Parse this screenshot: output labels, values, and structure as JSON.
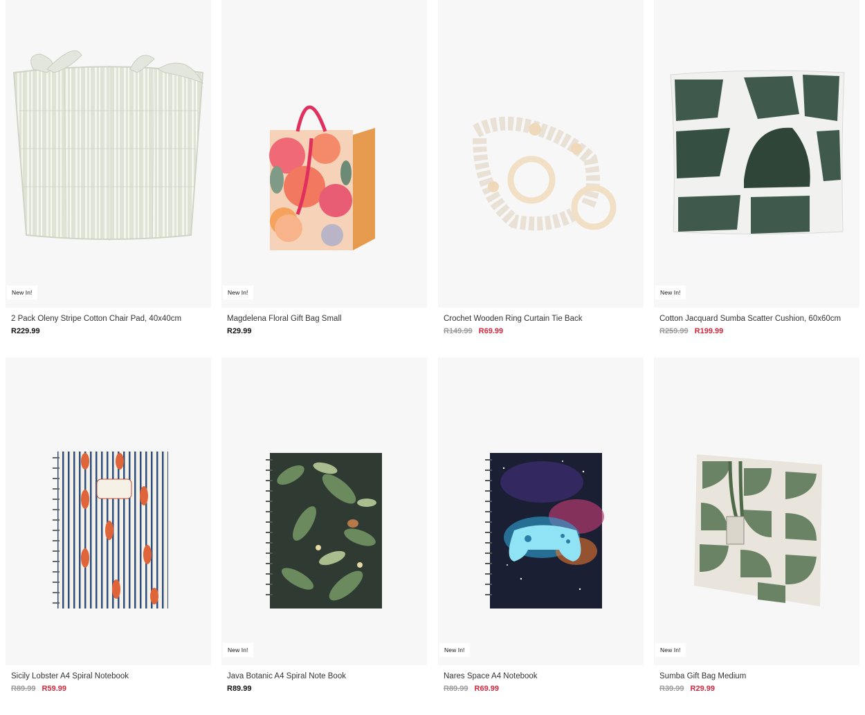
{
  "badge_label": "New In!",
  "colors": {
    "sale": "#d5263a",
    "regular": "#111111",
    "strike": "#9a9a9a",
    "card_bg": "#f7f7f7"
  },
  "products": [
    {
      "title": "2 Pack Oleny Stripe Cotton Chair Pad, 40x40cm",
      "price": "R229.99",
      "old_price": "",
      "sale_price": "",
      "badge": "New In!"
    },
    {
      "title": "Magdelena Floral Gift Bag Small",
      "price": "R29.99",
      "old_price": "",
      "sale_price": "",
      "badge": "New In!"
    },
    {
      "title": "Crochet Wooden Ring Curtain Tie Back",
      "price": "",
      "old_price": "R149.99",
      "sale_price": "R69.99",
      "badge": ""
    },
    {
      "title": "Cotton Jacquard Sumba Scatter Cushion, 60x60cm",
      "price": "",
      "old_price": "R259.99",
      "sale_price": "R199.99",
      "badge": "New In!"
    },
    {
      "title": "Sicily Lobster A4 Spiral Notebook",
      "price": "",
      "old_price": "R89.99",
      "sale_price": "R59.99",
      "badge": ""
    },
    {
      "title": "Java Botanic A4 Spiral Note Book",
      "price": "R89.99",
      "old_price": "",
      "sale_price": "",
      "badge": "New In!"
    },
    {
      "title": "Nares Space A4 Notebook",
      "price": "",
      "old_price": "R89.99",
      "sale_price": "R69.99",
      "badge": "New In!"
    },
    {
      "title": "Sumba Gift Bag Medium",
      "price": "",
      "old_price": "R39.99",
      "sale_price": "R29.99",
      "badge": "New In!"
    }
  ]
}
